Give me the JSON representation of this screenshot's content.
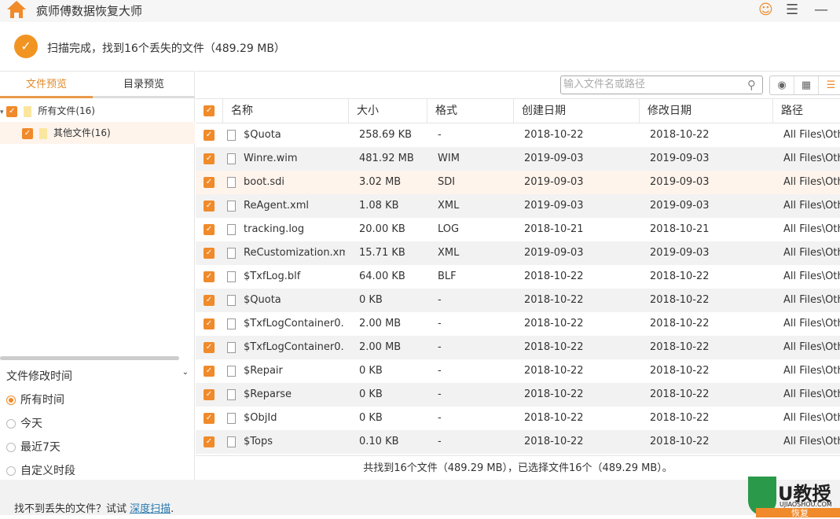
{
  "app": {
    "title": "疯师傅数据恢复大师"
  },
  "status": {
    "text": "扫描完成，找到16个丢失的文件（489.29 MB）"
  },
  "left": {
    "tabs": [
      "文件预览",
      "目录预览"
    ],
    "tree": [
      {
        "label": "所有文件(16)"
      },
      {
        "label": "其他文件(16)"
      }
    ],
    "filter_title": "文件修改时间",
    "filters": [
      "所有时间",
      "今天",
      "最近7天",
      "自定义时段"
    ],
    "selected_filter": "所有时间"
  },
  "search": {
    "placeholder": "输入文件名或路径"
  },
  "table": {
    "columns": [
      "名称",
      "大小",
      "格式",
      "创建日期",
      "修改日期",
      "路径"
    ],
    "rows": [
      [
        "$Quota",
        "258.69 KB",
        "-",
        "2018-10-22",
        "2018-10-22",
        "All Files\\Oth"
      ],
      [
        "Winre.wim",
        "481.92 MB",
        "WIM",
        "2019-09-03",
        "2019-09-03",
        "All Files\\Oth"
      ],
      [
        "boot.sdi",
        "3.02 MB",
        "SDI",
        "2019-09-03",
        "2019-09-03",
        "All Files\\Oth"
      ],
      [
        "ReAgent.xml",
        "1.08 KB",
        "XML",
        "2019-09-03",
        "2019-09-03",
        "All Files\\Oth"
      ],
      [
        "tracking.log",
        "20.00 KB",
        "LOG",
        "2018-10-21",
        "2018-10-21",
        "All Files\\Oth"
      ],
      [
        "ReCustomization.xml",
        "15.71 KB",
        "XML",
        "2019-09-03",
        "2019-09-03",
        "All Files\\Oth"
      ],
      [
        "$TxfLog.blf",
        "64.00 KB",
        "BLF",
        "2018-10-22",
        "2018-10-22",
        "All Files\\Oth"
      ],
      [
        "$Quota",
        "0 KB",
        "-",
        "2018-10-22",
        "2018-10-22",
        "All Files\\Oth"
      ],
      [
        "$TxfLogContainer0...",
        "2.00 MB",
        "-",
        "2018-10-22",
        "2018-10-22",
        "All Files\\Oth"
      ],
      [
        "$TxfLogContainer0...",
        "2.00 MB",
        "-",
        "2018-10-22",
        "2018-10-22",
        "All Files\\Oth"
      ],
      [
        "$Repair",
        "0 KB",
        "-",
        "2018-10-22",
        "2018-10-22",
        "All Files\\Oth"
      ],
      [
        "$Reparse",
        "0 KB",
        "-",
        "2018-10-22",
        "2018-10-22",
        "All Files\\Oth"
      ],
      [
        "$ObjId",
        "0 KB",
        "-",
        "2018-10-22",
        "2018-10-22",
        "All Files\\Oth"
      ],
      [
        "$Tops",
        "0.10 KB",
        "-",
        "2018-10-22",
        "2018-10-22",
        "All Files\\Oth"
      ]
    ]
  },
  "summary": "共找到16个文件（489.29 MB），已选择文件16个（489.29 MB）。",
  "bottom": {
    "text": "找不到丢失的文件？试试 ",
    "link": "深度扫描",
    "suffix": "."
  },
  "watermark": {
    "text": "U教授",
    "url": "UJIAOSHOU.COM",
    "sub": "恢复"
  },
  "colors": {
    "accent": "#f08a2a"
  }
}
